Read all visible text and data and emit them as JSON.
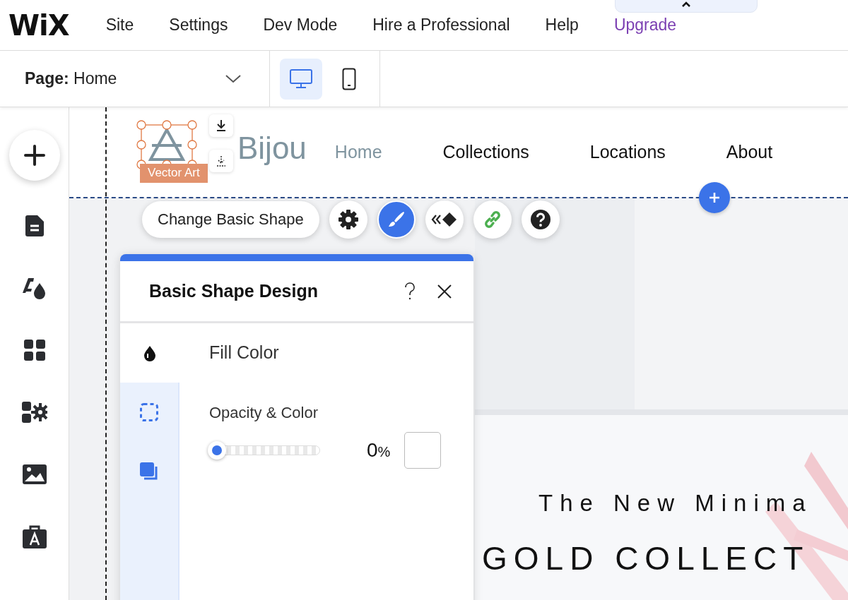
{
  "top_bar": {
    "logo": "WiX",
    "menu": [
      {
        "label": "Site",
        "kind": "item"
      },
      {
        "label": "Settings",
        "kind": "item"
      },
      {
        "label": "Dev Mode",
        "kind": "item"
      },
      {
        "label": "Hire a Professional",
        "kind": "item"
      },
      {
        "label": "Help",
        "kind": "item"
      },
      {
        "label": "Upgrade",
        "kind": "upgrade"
      }
    ]
  },
  "page_bar": {
    "label": "Page:",
    "value": "Home",
    "devices": [
      {
        "kind": "desktop",
        "selected": true
      },
      {
        "kind": "mobile",
        "selected": false
      }
    ]
  },
  "sidebar": {
    "items": [
      {
        "kind": "add"
      },
      {
        "kind": "pages"
      },
      {
        "kind": "theme"
      },
      {
        "kind": "apps"
      },
      {
        "kind": "widgets"
      },
      {
        "kind": "media"
      },
      {
        "kind": "business"
      }
    ]
  },
  "site": {
    "logo": "Bijou",
    "nav": [
      {
        "label": "Home",
        "selected": true
      },
      {
        "label": "Collections",
        "selected": false
      },
      {
        "label": "Locations",
        "selected": false
      },
      {
        "label": "About",
        "selected": false
      }
    ],
    "selection_label": "Vector Art",
    "hero": {
      "subtitle": "The New Minima",
      "title": "GOLD COLLECT"
    }
  },
  "toolbar": {
    "button": "Change Basic Shape",
    "tools": [
      {
        "kind": "settings",
        "selected": false
      },
      {
        "kind": "design",
        "selected": true
      },
      {
        "kind": "animation",
        "selected": false
      },
      {
        "kind": "link",
        "selected": false
      },
      {
        "kind": "help",
        "selected": false
      }
    ]
  },
  "panel": {
    "title": "Basic Shape Design",
    "tabs": [
      {
        "kind": "fill",
        "selected": true
      },
      {
        "kind": "border",
        "selected": false
      },
      {
        "kind": "shadow",
        "selected": false
      }
    ],
    "section": "Fill Color",
    "opacity_label": "Opacity & Color",
    "opacity": {
      "level": 0,
      "value": "0",
      "unit": "%"
    }
  }
}
